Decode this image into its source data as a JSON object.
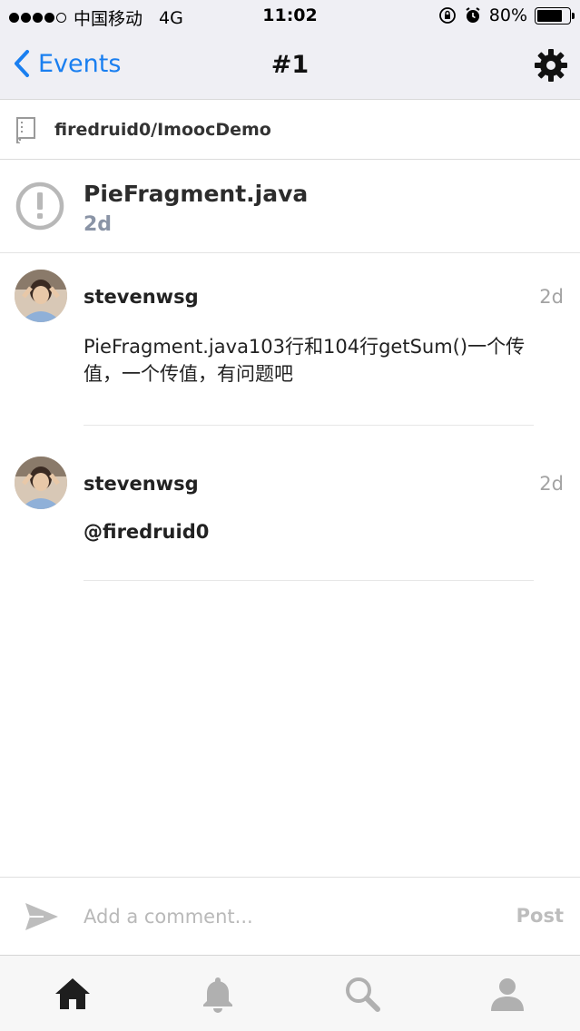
{
  "status_bar": {
    "carrier": "中国移动",
    "network": "4G",
    "time": "11:02",
    "battery": "80%",
    "battery_level": 0.8
  },
  "nav": {
    "back_label": "Events",
    "title": "#1",
    "accent_color": "#1a7ff0"
  },
  "repo": {
    "name": "firedruid0/ImoocDemo"
  },
  "issue": {
    "title": "PieFragment.java",
    "age": "2d",
    "icon": "issue-open-icon"
  },
  "comments": [
    {
      "user": "stevenwsg",
      "age": "2d",
      "body": "PieFragment.java103行和104行getSum()一个传值，一个传值，有问题吧"
    },
    {
      "user": "stevenwsg",
      "age": "2d",
      "body": "@firedruid0"
    }
  ],
  "composer": {
    "placeholder": "Add a comment...",
    "post_label": "Post"
  },
  "tab_bar": {
    "items": [
      "home-icon",
      "bell-icon",
      "search-icon",
      "profile-icon"
    ]
  }
}
